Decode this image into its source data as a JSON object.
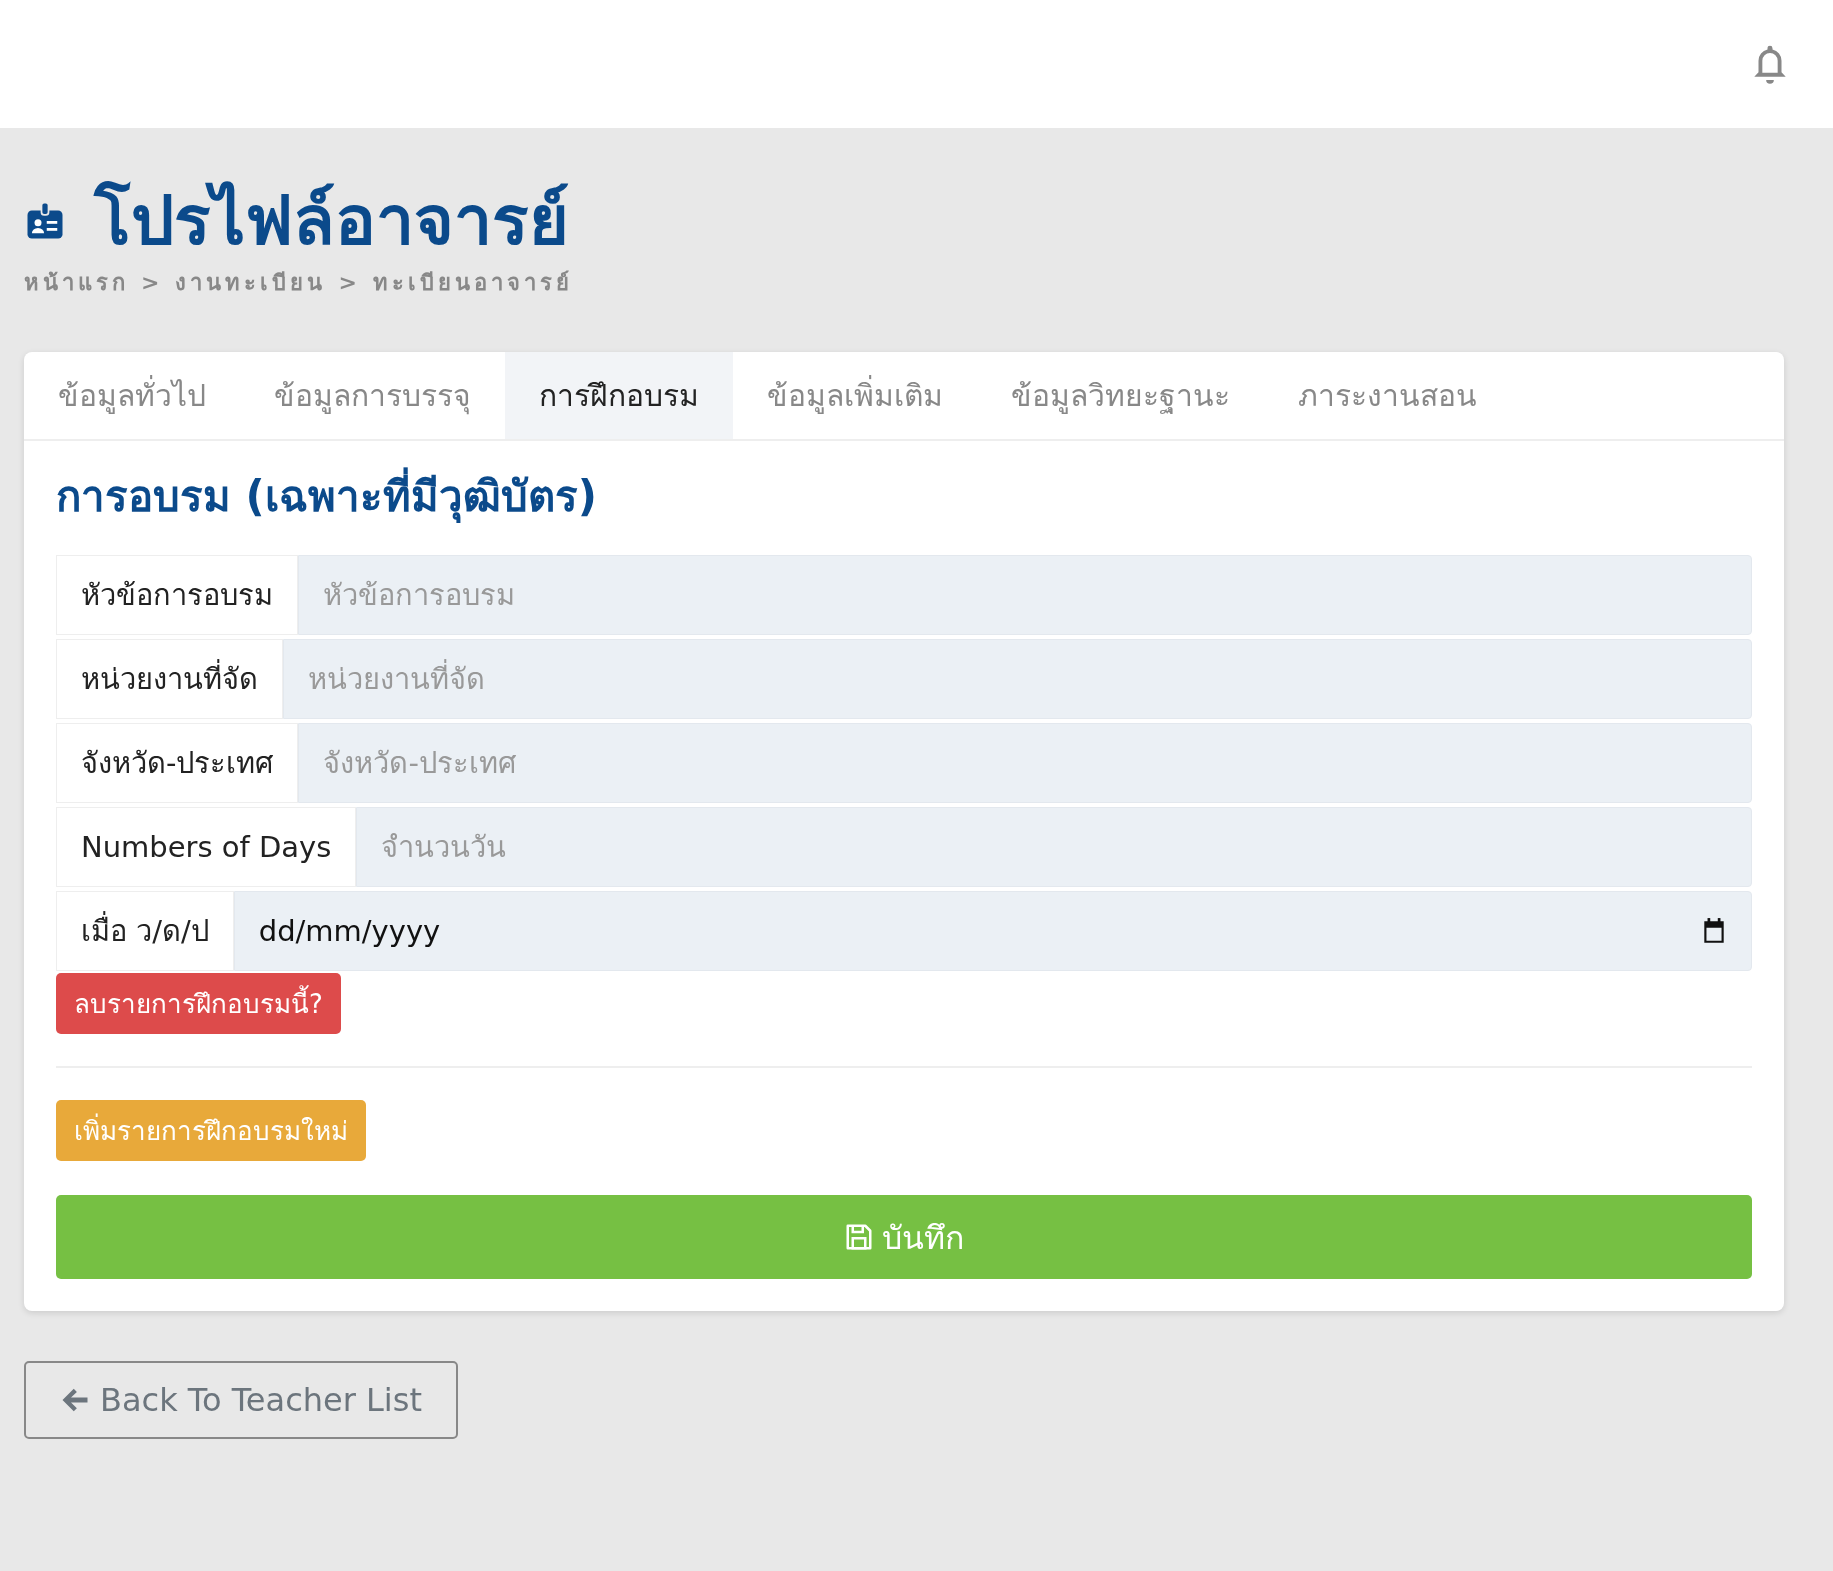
{
  "page": {
    "title": "โปรไฟล์อาจารย์",
    "breadcrumb": [
      "หน้าแรก",
      "งานทะเบียน",
      "ทะเบียนอาจารย์"
    ],
    "separator": ">"
  },
  "tabs": [
    {
      "label": "ข้อมูลทั่วไป",
      "selected": false
    },
    {
      "label": "ข้อมูลการบรรจุ",
      "selected": false
    },
    {
      "label": "การฝึกอบรม",
      "selected": true
    },
    {
      "label": "ข้อมูลเพิ่มเติม",
      "selected": false
    },
    {
      "label": "ข้อมูลวิทยะฐานะ",
      "selected": false
    },
    {
      "label": "ภาระงานสอน",
      "selected": false
    }
  ],
  "section": {
    "title": "การอบรม (เฉพาะที่มีวุฒิบัตร)"
  },
  "fields": [
    {
      "kind": "text",
      "label": "หัวข้อการอบรม",
      "placeholder": "หัวข้อการอบรม"
    },
    {
      "kind": "text",
      "label": "หน่วยงานที่จัด",
      "placeholder": "หน่วยงานที่จัด"
    },
    {
      "kind": "text",
      "label": "จังหวัด-ประเทศ",
      "placeholder": "จังหวัด-ประเทศ"
    },
    {
      "kind": "text",
      "label": "Numbers of Days",
      "placeholder": "จำนวนวัน"
    },
    {
      "kind": "date",
      "label": "เมื่อ ว/ด/ป",
      "value": "dd/mm/yyyy"
    }
  ],
  "delete_button": "ลบรายการฝึกอบรมนี้?",
  "add_button": "เพิ่มรายการฝึกอบรมใหม่",
  "save_button": "บันทึก",
  "back_button": "Back To Teacher List"
}
